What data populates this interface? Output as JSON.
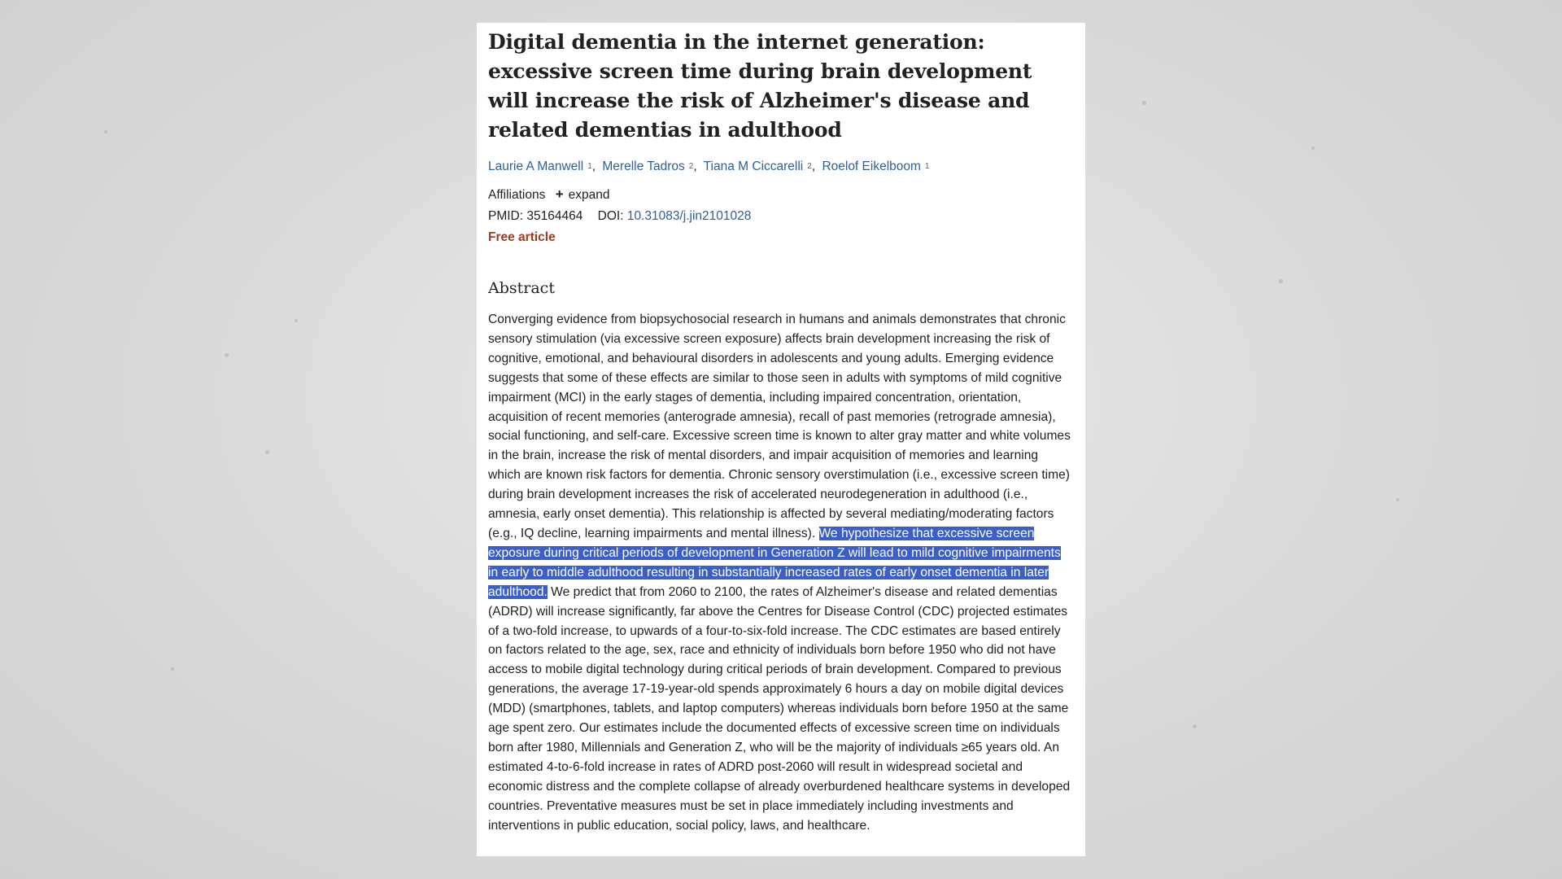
{
  "article": {
    "title": "Digital dementia in the internet generation: excessive screen time during brain development will increase the risk of Alzheimer's disease and related dementias in adulthood",
    "authors": [
      {
        "name": "Laurie A Manwell",
        "affiliation": "1"
      },
      {
        "name": "Merelle Tadros",
        "affiliation": "2"
      },
      {
        "name": "Tiana M Ciccarelli",
        "affiliation": "2"
      },
      {
        "name": "Roelof Eikelboom",
        "affiliation": "1"
      }
    ],
    "author_separator": ",",
    "affiliations_label": "Affiliations",
    "expand_label": "expand",
    "plus_icon": "+",
    "pmid_label": "PMID:",
    "pmid": "35164464",
    "doi_label": "DOI:",
    "doi": "10.31083/j.jin2101028",
    "free_article": "Free article",
    "abstract_heading": "Abstract",
    "abstract_before": "Converging evidence from biopsychosocial research in humans and animals demonstrates that chronic sensory stimulation (via excessive screen exposure) affects brain development increasing the risk of cognitive, emotional, and behavioural disorders in adolescents and young adults. Emerging evidence suggests that some of these effects are similar to those seen in adults with symptoms of mild cognitive impairment (MCI) in the early stages of dementia, including impaired concentration, orientation, acquisition of recent memories (anterograde amnesia), recall of past memories (retrograde amnesia), social functioning, and self-care. Excessive screen time is known to alter gray matter and white volumes in the brain, increase the risk of mental disorders, and impair acquisition of memories and learning which are known risk factors for dementia. Chronic sensory overstimulation (i.e., excessive screen time) during brain development increases the risk of accelerated neurodegeneration in adulthood (i.e., amnesia, early onset dementia). This relationship is affected by several mediating/moderating factors (e.g., IQ decline, learning impairments and mental illness). ",
    "abstract_highlighted": "We hypothesize that excessive screen exposure during critical periods of development in Generation Z will lead to mild cognitive impairments in early to middle adulthood resulting in substantially increased rates of early onset dementia in later adulthood.",
    "abstract_after": " We predict that from 2060 to 2100, the rates of Alzheimer's disease and related dementias (ADRD) will increase significantly, far above the Centres for Disease Control (CDC) projected estimates of a two-fold increase, to upwards of a four-to-six-fold increase. The CDC estimates are based entirely on factors related to the age, sex, race and ethnicity of individuals born before 1950 who did not have access to mobile digital technology during critical periods of brain development. Compared to previous generations, the average 17-19-year-old spends approximately 6 hours a day on mobile digital devices (MDD) (smartphones, tablets, and laptop computers) whereas individuals born before 1950 at the same age spent zero. Our estimates include the documented effects of excessive screen time on individuals born after 1980, Millennials and Generation Z, who will be the majority of individuals ≥65 years old. An estimated 4-to-6-fold increase in rates of ADRD post-2060 will result in widespread societal and economic distress and the complete collapse of already overburdened healthcare systems in developed countries. Preventative measures must be set in place immediately including investments and interventions in public education, social policy, laws, and healthcare.",
    "colors": {
      "link": "#2e5f98",
      "free_article": "#a4391c",
      "highlight_bg": "#3b5fc7",
      "highlight_fg": "#ffffff",
      "background": "#dcdcdc"
    }
  }
}
